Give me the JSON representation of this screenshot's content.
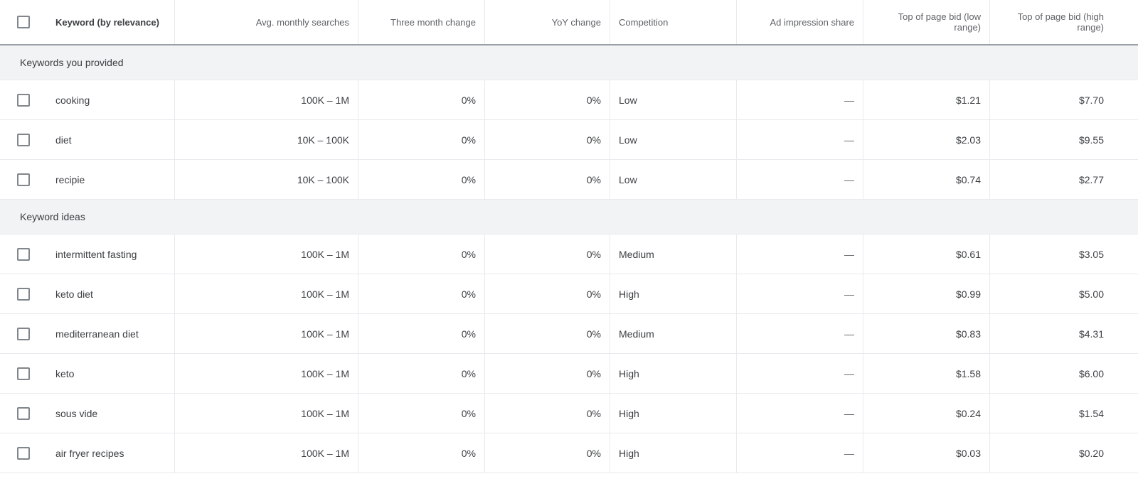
{
  "columns": {
    "keyword": "Keyword (by relevance)",
    "searches": "Avg. monthly searches",
    "three_month": "Three month change",
    "yoy": "YoY change",
    "competition": "Competition",
    "impression": "Ad impression share",
    "bid_low": "Top of page bid (low range)",
    "bid_high": "Top of page bid (high range)"
  },
  "sections": [
    {
      "title": "Keywords you provided",
      "rows": [
        {
          "keyword": "cooking",
          "searches": "100K – 1M",
          "three_month": "0%",
          "yoy": "0%",
          "competition": "Low",
          "impression": "—",
          "bid_low": "$1.21",
          "bid_high": "$7.70"
        },
        {
          "keyword": "diet",
          "searches": "10K – 100K",
          "three_month": "0%",
          "yoy": "0%",
          "competition": "Low",
          "impression": "—",
          "bid_low": "$2.03",
          "bid_high": "$9.55"
        },
        {
          "keyword": "recipie",
          "searches": "10K – 100K",
          "three_month": "0%",
          "yoy": "0%",
          "competition": "Low",
          "impression": "—",
          "bid_low": "$0.74",
          "bid_high": "$2.77"
        }
      ]
    },
    {
      "title": "Keyword ideas",
      "rows": [
        {
          "keyword": "intermittent fasting",
          "searches": "100K – 1M",
          "three_month": "0%",
          "yoy": "0%",
          "competition": "Medium",
          "impression": "—",
          "bid_low": "$0.61",
          "bid_high": "$3.05"
        },
        {
          "keyword": "keto diet",
          "searches": "100K – 1M",
          "three_month": "0%",
          "yoy": "0%",
          "competition": "High",
          "impression": "—",
          "bid_low": "$0.99",
          "bid_high": "$5.00"
        },
        {
          "keyword": "mediterranean diet",
          "searches": "100K – 1M",
          "three_month": "0%",
          "yoy": "0%",
          "competition": "Medium",
          "impression": "—",
          "bid_low": "$0.83",
          "bid_high": "$4.31"
        },
        {
          "keyword": "keto",
          "searches": "100K – 1M",
          "three_month": "0%",
          "yoy": "0%",
          "competition": "High",
          "impression": "—",
          "bid_low": "$1.58",
          "bid_high": "$6.00"
        },
        {
          "keyword": "sous vide",
          "searches": "100K – 1M",
          "three_month": "0%",
          "yoy": "0%",
          "competition": "High",
          "impression": "—",
          "bid_low": "$0.24",
          "bid_high": "$1.54"
        },
        {
          "keyword": "air fryer recipes",
          "searches": "100K – 1M",
          "three_month": "0%",
          "yoy": "0%",
          "competition": "High",
          "impression": "—",
          "bid_low": "$0.03",
          "bid_high": "$0.20"
        }
      ]
    }
  ]
}
